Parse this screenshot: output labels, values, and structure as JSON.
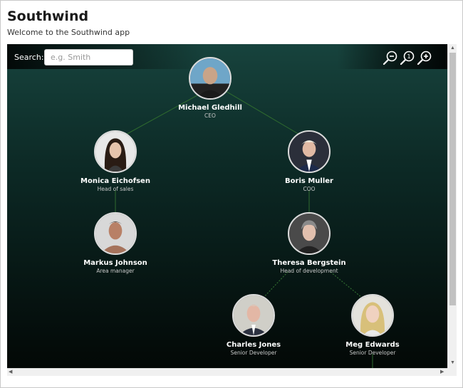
{
  "app": {
    "title": "Southwind",
    "subtitle": "Welcome to the Southwind app"
  },
  "search": {
    "label": "Search:",
    "placeholder": "e.g. Smith",
    "value": ""
  },
  "zoom": {
    "zoom_out_icon": "zoom-out-icon",
    "reset_icon": "zoom-reset-icon",
    "zoom_in_icon": "zoom-in-icon",
    "reset_label": "1"
  },
  "colors": {
    "background_top": "#17433d",
    "background_bottom": "#030806",
    "edge": "#2f6b2f",
    "node_name": "#ffffff",
    "node_title": "#c9c9c9"
  },
  "org": {
    "people": [
      {
        "name": "Michael Gledhill",
        "title": "CEO"
      },
      {
        "name": "Monica Eichofsen",
        "title": "Head of sales"
      },
      {
        "name": "Boris Muller",
        "title": "COO"
      },
      {
        "name": "Markus Johnson",
        "title": "Area manager"
      },
      {
        "name": "Theresa Bergstein",
        "title": "Head of development"
      },
      {
        "name": "Charles Jones",
        "title": "Senior Developer"
      },
      {
        "name": "Meg Edwards",
        "title": "Senior Developer"
      }
    ]
  }
}
